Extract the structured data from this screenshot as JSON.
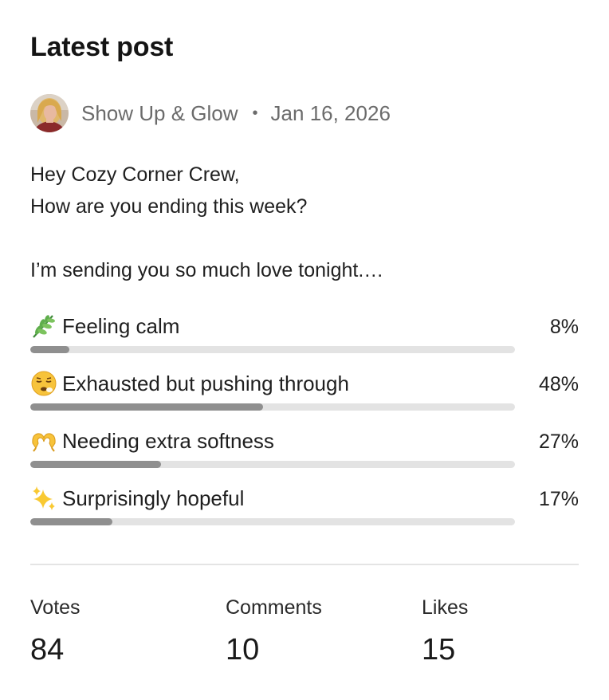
{
  "header": {
    "title": "Latest post"
  },
  "post": {
    "author": "Show Up & Glow",
    "separator": "•",
    "date": "Jan 16, 2026",
    "body_lines": [
      "Hey Cozy Corner Crew,",
      "How are you ending this week?",
      "",
      "I’m sending you so much love tonight.…"
    ]
  },
  "poll": {
    "options": [
      {
        "emoji": "herb-emoji-icon",
        "label": "Feeling calm",
        "percent": "8%",
        "fraction": 0.08
      },
      {
        "emoji": "tired-face-emoji-icon",
        "label": "Exhausted but pushing through",
        "percent": "48%",
        "fraction": 0.48
      },
      {
        "emoji": "heart-hands-emoji-icon",
        "label": "Needing extra softness",
        "percent": "27%",
        "fraction": 0.27
      },
      {
        "emoji": "sparkles-emoji-icon",
        "label": "Surprisingly hopeful",
        "percent": "17%",
        "fraction": 0.17
      }
    ],
    "bar_track_color": "#e3e3e3",
    "bar_fill_color": "#8f8f8f"
  },
  "stats": {
    "votes_label": "Votes",
    "votes_value": "84",
    "comments_label": "Comments",
    "comments_value": "10",
    "likes_label": "Likes",
    "likes_value": "15"
  }
}
